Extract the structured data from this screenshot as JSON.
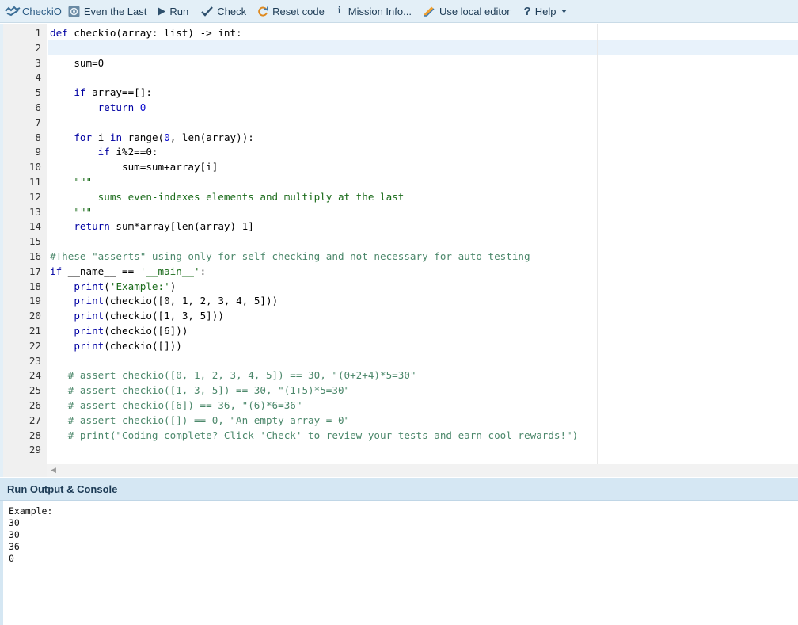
{
  "toolbar": {
    "logo_text": "CheckiO",
    "mission": "Even the Last",
    "run": "Run",
    "check": "Check",
    "reset": "Reset code",
    "info": "Mission Info...",
    "local_editor": "Use local editor",
    "help": "Help"
  },
  "colors": {
    "toolbar_bg": "#e3eff7",
    "keyword": "#0000a2",
    "comment": "#4c886b",
    "active_line": "#e8f2fb"
  },
  "editor": {
    "lines": [
      {
        "n": "1",
        "tokens": [
          [
            "kw",
            "def "
          ],
          [
            "plain",
            "checkio(array: list) -> int:"
          ]
        ]
      },
      {
        "n": "2",
        "tokens": []
      },
      {
        "n": "3",
        "tokens": [
          [
            "plain",
            "    sum=0"
          ]
        ]
      },
      {
        "n": "4",
        "tokens": []
      },
      {
        "n": "5",
        "tokens": [
          [
            "plain",
            "    "
          ],
          [
            "kw",
            "if "
          ],
          [
            "plain",
            "array==[]:"
          ]
        ]
      },
      {
        "n": "6",
        "tokens": [
          [
            "plain",
            "        "
          ],
          [
            "kw",
            "return "
          ],
          [
            "nm",
            "0"
          ]
        ]
      },
      {
        "n": "7",
        "tokens": []
      },
      {
        "n": "8",
        "tokens": [
          [
            "plain",
            "    "
          ],
          [
            "kw",
            "for "
          ],
          [
            "plain",
            "i "
          ],
          [
            "kw",
            "in "
          ],
          [
            "plain",
            "range("
          ],
          [
            "nm",
            "0"
          ],
          [
            "plain",
            ", len(array)):"
          ]
        ]
      },
      {
        "n": "9",
        "tokens": [
          [
            "plain",
            "        "
          ],
          [
            "kw",
            "if "
          ],
          [
            "plain",
            "i%2==0:"
          ]
        ]
      },
      {
        "n": "10",
        "tokens": [
          [
            "plain",
            "            sum=sum+array[i]"
          ]
        ]
      },
      {
        "n": "11",
        "tokens": [
          [
            "st",
            "    \"\"\""
          ]
        ]
      },
      {
        "n": "12",
        "tokens": [
          [
            "st",
            "        sums even-indexes elements and multiply at the last"
          ]
        ]
      },
      {
        "n": "13",
        "tokens": [
          [
            "st",
            "    \"\"\""
          ]
        ]
      },
      {
        "n": "14",
        "tokens": [
          [
            "plain",
            "    "
          ],
          [
            "kw",
            "return "
          ],
          [
            "plain",
            "sum*array[len(array)-1]"
          ]
        ]
      },
      {
        "n": "15",
        "tokens": []
      },
      {
        "n": "16",
        "tokens": [
          [
            "cm",
            "#These \"asserts\" using only for self-checking and not necessary for auto-testing"
          ]
        ]
      },
      {
        "n": "17",
        "tokens": [
          [
            "kw",
            "if "
          ],
          [
            "plain",
            "__name__ == "
          ],
          [
            "st",
            "'__main__'"
          ],
          [
            "plain",
            ":"
          ]
        ]
      },
      {
        "n": "18",
        "tokens": [
          [
            "plain",
            "    "
          ],
          [
            "kw",
            "print"
          ],
          [
            "plain",
            "("
          ],
          [
            "st",
            "'Example:'"
          ],
          [
            "plain",
            ")"
          ]
        ]
      },
      {
        "n": "19",
        "tokens": [
          [
            "plain",
            "    "
          ],
          [
            "kw",
            "print"
          ],
          [
            "plain",
            "(checkio([0, 1, 2, 3, 4, 5]))"
          ]
        ]
      },
      {
        "n": "20",
        "tokens": [
          [
            "plain",
            "    "
          ],
          [
            "kw",
            "print"
          ],
          [
            "plain",
            "(checkio([1, 3, 5]))"
          ]
        ]
      },
      {
        "n": "21",
        "tokens": [
          [
            "plain",
            "    "
          ],
          [
            "kw",
            "print"
          ],
          [
            "plain",
            "(checkio([6]))"
          ]
        ]
      },
      {
        "n": "22",
        "tokens": [
          [
            "plain",
            "    "
          ],
          [
            "kw",
            "print"
          ],
          [
            "plain",
            "(checkio([]))"
          ]
        ]
      },
      {
        "n": "23",
        "tokens": []
      },
      {
        "n": "24",
        "tokens": [
          [
            "cm",
            "   # assert checkio([0, 1, 2, 3, 4, 5]) == 30, \"(0+2+4)*5=30\""
          ]
        ]
      },
      {
        "n": "25",
        "tokens": [
          [
            "cm",
            "   # assert checkio([1, 3, 5]) == 30, \"(1+5)*5=30\""
          ]
        ]
      },
      {
        "n": "26",
        "tokens": [
          [
            "cm",
            "   # assert checkio([6]) == 36, \"(6)*6=36\""
          ]
        ]
      },
      {
        "n": "27",
        "tokens": [
          [
            "cm",
            "   # assert checkio([]) == 0, \"An empty array = 0\""
          ]
        ]
      },
      {
        "n": "28",
        "tokens": [
          [
            "cm",
            "   # print(\"Coding complete? Click 'Check' to review your tests and earn cool rewards!\")"
          ]
        ]
      },
      {
        "n": "29",
        "tokens": []
      }
    ]
  },
  "output": {
    "title": "Run Output & Console",
    "lines": [
      "Example:",
      "30",
      "30",
      "36",
      "0"
    ]
  }
}
